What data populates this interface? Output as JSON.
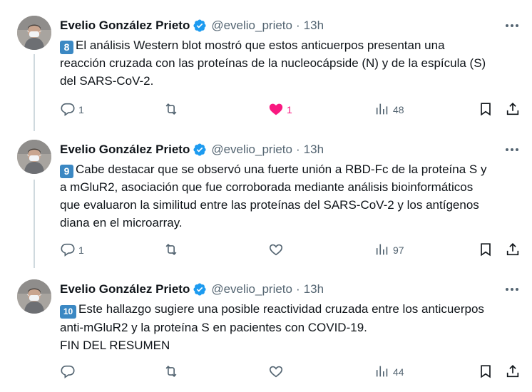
{
  "tweets": [
    {
      "name": "Evelio González Prieto",
      "handle": "@evelio_prieto",
      "separator": "·",
      "time": "13h",
      "number": "8",
      "lines": [
        "El análisis Western blot mostró que estos anticuerpos presentan una",
        "reacción cruzada con las proteínas de la nucleocápside (N) y de la espícula (S)",
        "del SARS-CoV-2."
      ],
      "replies": "1",
      "retweets": "",
      "likes": "1",
      "liked": true,
      "views": "48"
    },
    {
      "name": "Evelio González Prieto",
      "handle": "@evelio_prieto",
      "separator": "·",
      "time": "13h",
      "number": "9",
      "lines": [
        "Cabe destacar que se observó una fuerte unión a RBD-Fc de la proteína S y",
        "a mGluR2, asociación que fue corroborada mediante análisis bioinformáticos",
        "que evaluaron la similitud entre las proteínas del SARS-CoV-2 y los antígenos",
        "diana en el microarray."
      ],
      "replies": "1",
      "retweets": "",
      "likes": "",
      "liked": false,
      "views": "97"
    },
    {
      "name": "Evelio González Prieto",
      "handle": "@evelio_prieto",
      "separator": "·",
      "time": "13h",
      "number": "10",
      "lines": [
        "Este hallazgo sugiere una posible reactividad cruzada entre los anticuerpos",
        "anti-mGluR2 y la proteína S en pacientes con COVID-19.",
        "FIN DEL RESUMEN"
      ],
      "replies": "",
      "retweets": "",
      "likes": "",
      "liked": false,
      "views": "44"
    }
  ],
  "colors": {
    "verified": "#1d9bf0",
    "like_active": "#f91880",
    "secondary_text": "#536471",
    "keycap": "#3b88c3"
  },
  "icons": [
    "verified-badge-icon",
    "more-icon",
    "reply-icon",
    "retweet-icon",
    "like-icon",
    "views-icon",
    "bookmark-icon",
    "share-icon"
  ]
}
